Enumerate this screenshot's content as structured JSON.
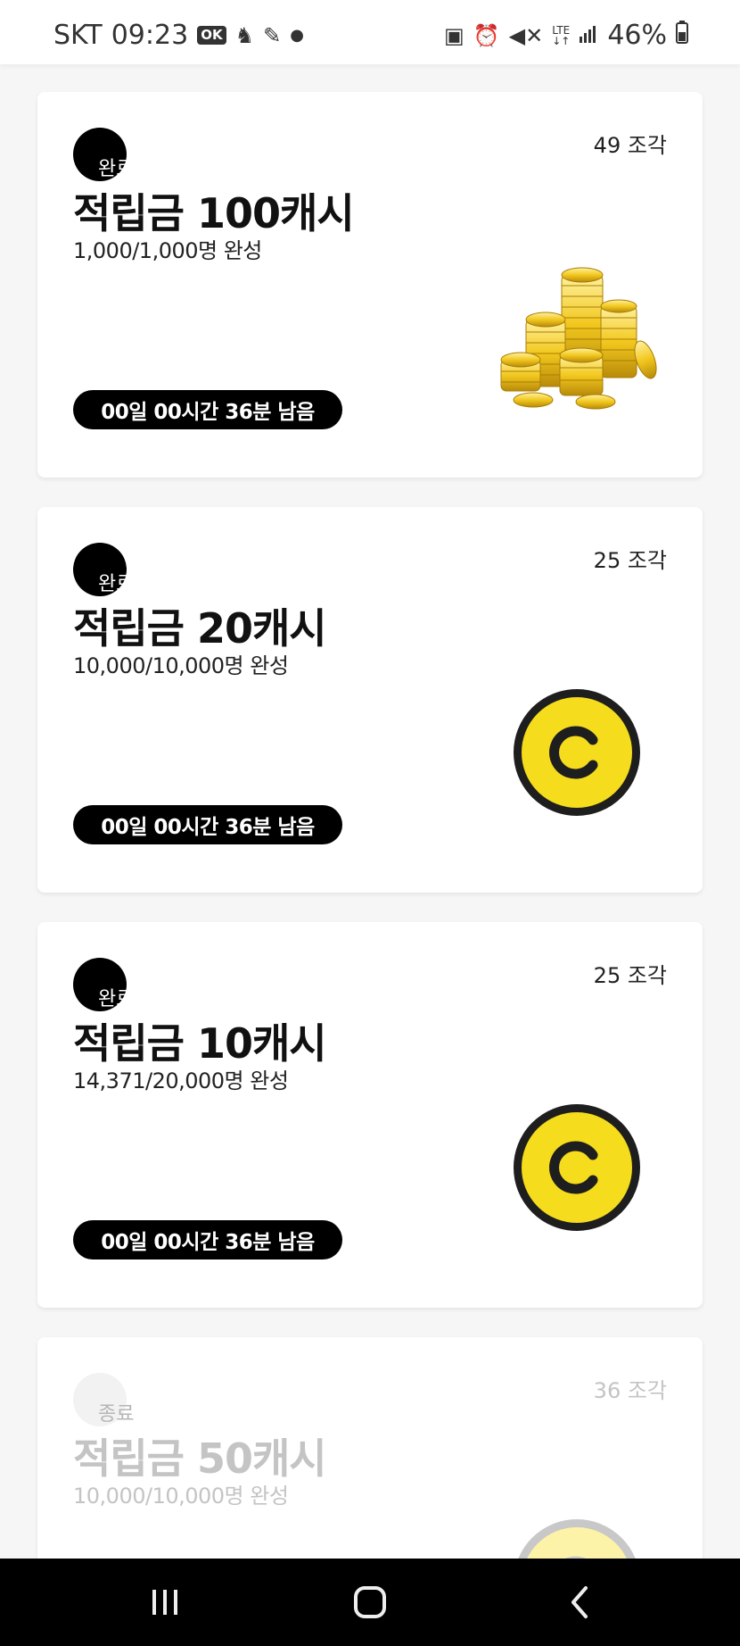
{
  "status_bar": {
    "carrier": "SKT",
    "time": "09:23",
    "ok_label": "OK",
    "network": "LTE",
    "battery": "46%"
  },
  "cards": [
    {
      "status": "완료",
      "pieces": "49 조각",
      "title": "적립금 100캐시",
      "progress": "1,000/1,000명 완성",
      "timer": "00일 00시간 36분 남음",
      "art": "gold-coins-stack-icon"
    },
    {
      "status": "완료",
      "pieces": "25 조각",
      "title": "적립금 20캐시",
      "progress": "10,000/10,000명 완성",
      "timer": "00일 00시간 36분 남음",
      "art": "c-coin-icon"
    },
    {
      "status": "완료",
      "pieces": "25 조각",
      "title": "적립금 10캐시",
      "progress": "14,371/20,000명 완성",
      "timer": "00일 00시간 36분 남음",
      "art": "c-coin-icon"
    },
    {
      "status": "종료",
      "pieces": "36 조각",
      "title": "적립금 50캐시",
      "progress": "10,000/10,000명 완성",
      "art": "c-coin-icon"
    }
  ],
  "colors": {
    "accent_yellow": "#f5dc1c",
    "badge_black": "#000000",
    "timer_bg": "#000000",
    "faded_text": "#c4c4c4"
  }
}
